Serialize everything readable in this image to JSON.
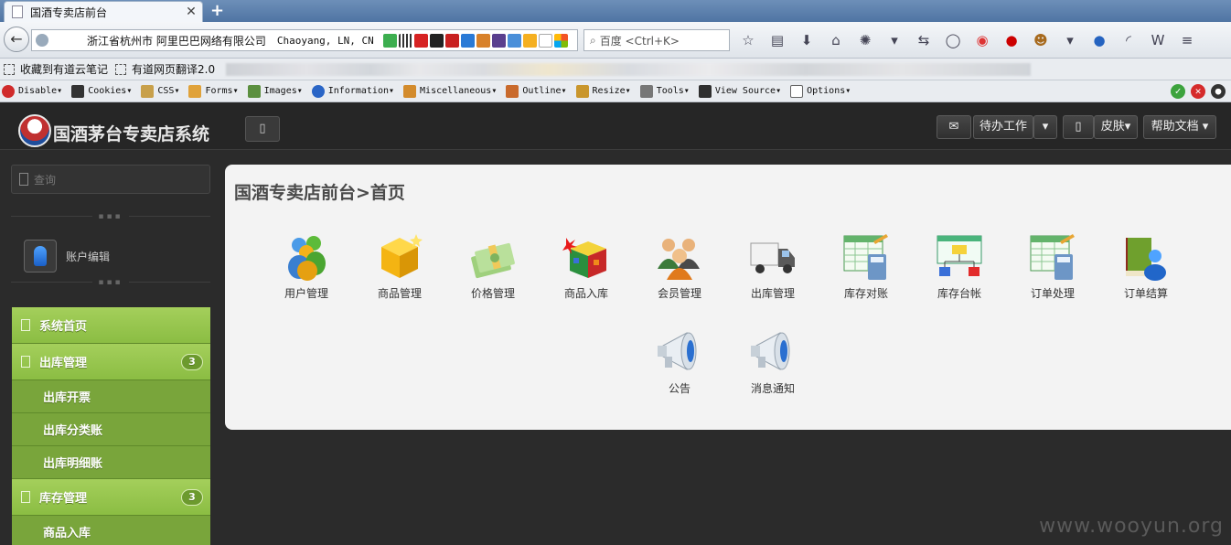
{
  "browser": {
    "tab_title": "国酒专卖店前台",
    "new_tab": "+",
    "tab_close": "✕",
    "url_text": "浙江省杭州市 阿里巴巴网络有限公司",
    "location_text": "Chaoyang, LN, CN",
    "search_placeholder": "百度 <Ctrl+K>",
    "bookmarks": [
      "收藏到有道云笔记",
      "有道网页翻译2.0"
    ],
    "webdev_items": [
      "Disable",
      "Cookies",
      "CSS",
      "Forms",
      "Images",
      "Information",
      "Miscellaneous",
      "Outline",
      "Resize",
      "Tools",
      "View Source",
      "Options"
    ]
  },
  "app": {
    "brand": "国酒茅台专卖店系统",
    "header": {
      "todo_label": "待办工作",
      "skin_label": "皮肤",
      "help_label": "帮助文档"
    },
    "sidebar": {
      "search_placeholder": "查询",
      "divider": "▪▪▪",
      "user_label": "账户编辑",
      "menu": [
        {
          "label": "系统首页"
        },
        {
          "label": "出库管理",
          "badge": "3"
        },
        {
          "label": "出库开票"
        },
        {
          "label": "出库分类账"
        },
        {
          "label": "出库明细账"
        },
        {
          "label": "库存管理",
          "badge": "3"
        },
        {
          "label": "商品入库"
        }
      ]
    },
    "main": {
      "title": "国酒专卖店前台>首页",
      "tiles": [
        {
          "label": "用户管理",
          "icon": "users-icon"
        },
        {
          "label": "商品管理",
          "icon": "box-icon"
        },
        {
          "label": "价格管理",
          "icon": "money-icon"
        },
        {
          "label": "商品入库",
          "icon": "cube-icon"
        },
        {
          "label": "会员管理",
          "icon": "members-icon"
        },
        {
          "label": "出库管理",
          "icon": "truck-icon"
        },
        {
          "label": "库存对账",
          "icon": "spreadsheet-calc-icon"
        },
        {
          "label": "库存台帐",
          "icon": "org-chart-icon"
        },
        {
          "label": "订单处理",
          "icon": "spreadsheet-calc-icon"
        },
        {
          "label": "订单结算",
          "icon": "book-user-icon"
        },
        {
          "label": "公告",
          "icon": "megaphone-icon"
        },
        {
          "label": "消息通知",
          "icon": "megaphone-icon"
        }
      ]
    }
  },
  "watermark": "www.wooyun.org"
}
